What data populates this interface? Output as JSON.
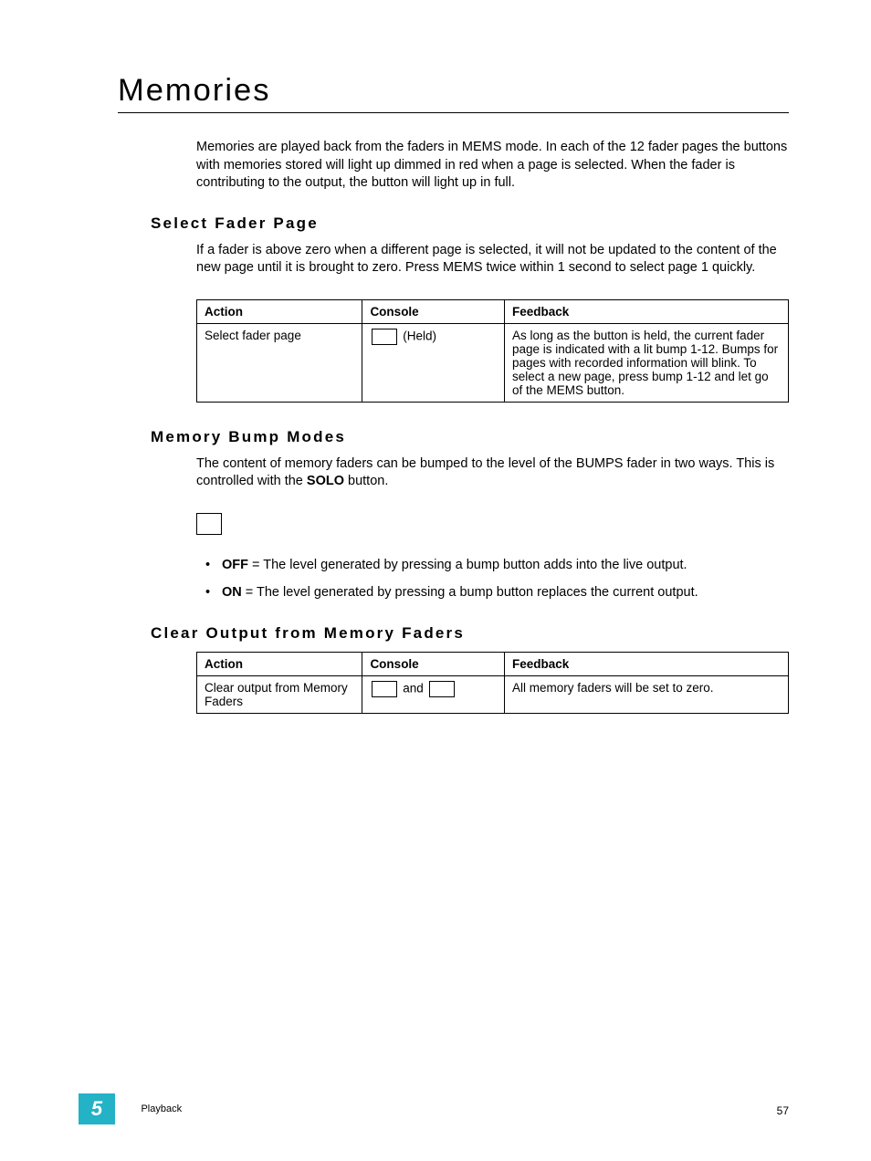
{
  "title": "Memories",
  "intro": "Memories are played back from the faders in MEMS mode. In each of the 12 fader pages the buttons with memories stored will light up dimmed in red when a page is selected. When the fader is contributing to the output, the button will light up in full.",
  "section1": {
    "heading": "Select Fader Page",
    "body": "If a fader is above zero when a different page is selected, it will not be updated to the content of the new page until it is brought to zero. Press MEMS twice within 1 second to select page 1 quickly.",
    "table": {
      "headers": [
        "Action",
        "Console",
        "Feedback"
      ],
      "row": {
        "action": "Select fader page",
        "console_after": "(Held)",
        "feedback": "As long as the button is held, the current fader page is indicated with a lit bump 1-12. Bumps for pages with recorded information will blink. To select a new page, press bump 1-12 and let go of the MEMS button."
      }
    }
  },
  "section2": {
    "heading": "Memory Bump Modes",
    "body_pre": "The content of memory faders can be bumped to the level of the BUMPS fader in two ways. This is controlled with the ",
    "body_bold": "SOLO",
    "body_post": " button.",
    "bullets": [
      {
        "label": "OFF",
        "text": " = The level generated by pressing a bump button adds into the live output."
      },
      {
        "label": "ON",
        "text": " = The level generated by pressing a bump button replaces the current output."
      }
    ]
  },
  "section3": {
    "heading": "Clear Output from Memory Faders",
    "table": {
      "headers": [
        "Action",
        "Console",
        "Feedback"
      ],
      "row": {
        "action": "Clear output from Memory Faders",
        "console_mid": "and",
        "feedback": "All memory faders will be set to zero."
      }
    }
  },
  "footer": {
    "chapter": "5",
    "section": "Playback",
    "page": "57"
  }
}
